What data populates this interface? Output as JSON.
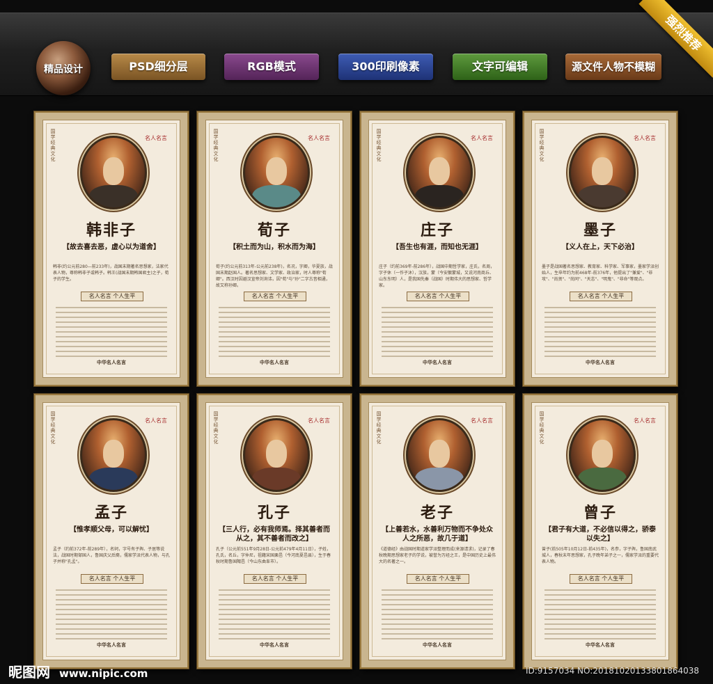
{
  "toolbar": {
    "logo_label": "精品设计",
    "buttons": [
      "PSD细分层",
      "RGB模式",
      "300印刷像素",
      "文字可编辑",
      "源文件人物不模糊"
    ],
    "ribbon": "强烈推荐"
  },
  "common": {
    "section_title": "名人名言 个人生平",
    "footer": "中华名人名言",
    "vertical_text": "国学经典文化",
    "seal_text": "名人名言"
  },
  "posters": [
    {
      "name": "韩非子",
      "quote": "【故去喜去恶，虚心以为道舍】",
      "brief": "韩非(约公元前280—前233年)，战国末期著名思想家，法家代表人物，尊称韩非子或韩子。韩王(战国末期韩国君主)之子，荀子的学生。"
    },
    {
      "name": "荀子",
      "quote": "【积土而为山，积水而为海】",
      "brief": "荀子(约公元前313年-公元前238年)，名况，字卿，华夏族，战国末期赵国人。著名思想家、文学家、政治家，时人尊称\"荀卿\"。西汉时因避汉宣帝刘询讳，因\"荀\"与\"孙\"二字古音相通，故又称孙卿。"
    },
    {
      "name": "庄子",
      "quote": "【吾生也有涯，而知也无涯】",
      "brief": "庄子（约前369年-前286年），战国中期哲学家，庄氏，名周，字子休（一作子沐），汉族，蒙（今安徽蒙城，又说河南商丘、山东东明）人，是我国先秦（战国）时期伟大的思想家、哲学家。"
    },
    {
      "name": "墨子",
      "quote": "【义人在上，天下必治】",
      "brief": "墨子是战国著名思想家、教育家、科学家、军事家，墨家学派创始人，生卒年约为前468年-前376年，他提出了\"兼爱\"、\"非攻\"、\"尚贤\"、\"尚同\"、\"天志\"、\"明鬼\"、\"非命\"等观点。"
    },
    {
      "name": "孟子",
      "quote": "【惟孝顺父母，可以解忧】",
      "brief": "孟子（约前372年-前289年），名轲，字号有子舆、子居等说法，战国时期邹国人，鲁国庆父后裔，儒家学派代表人物，与孔子并称\"孔孟\"。"
    },
    {
      "name": "孔子",
      "quote": "【三人行，必有我师焉。择其善者而从之，其不善者而改之】",
      "brief": "孔子（公元前551年9月28日-公元前479年4月11日），子姓，孔氏，名丘，字仲尼，祖籍宋国栗邑（今河南夏邑县），生于春秋时期鲁国陬邑（今山东曲阜市）。"
    },
    {
      "name": "老子",
      "quote": "【上善若水，水善利万物而不争处众人之所恶，故几于道】",
      "brief": "《道德经》由战国时期道家学派整理而成(来源请求)，记录了春秋晚期思想家老子的学说，被誉为万经之王，是中国历史上最伟大的名著之一。"
    },
    {
      "name": "曾子",
      "quote": "【君子有大道，不必信以得之，骄泰以失之】",
      "brief": "曾子(前505年10月12日-前435年)，名参，字子舆，鲁国南武城人，春秋末年思想家，孔子晚年弟子之一，儒家学派的重要代表人物。"
    }
  ],
  "watermark": {
    "site_name": "昵图网",
    "url": "www.nipic.com",
    "id_text": "ID:9157034 NO:20181020133801864038"
  }
}
